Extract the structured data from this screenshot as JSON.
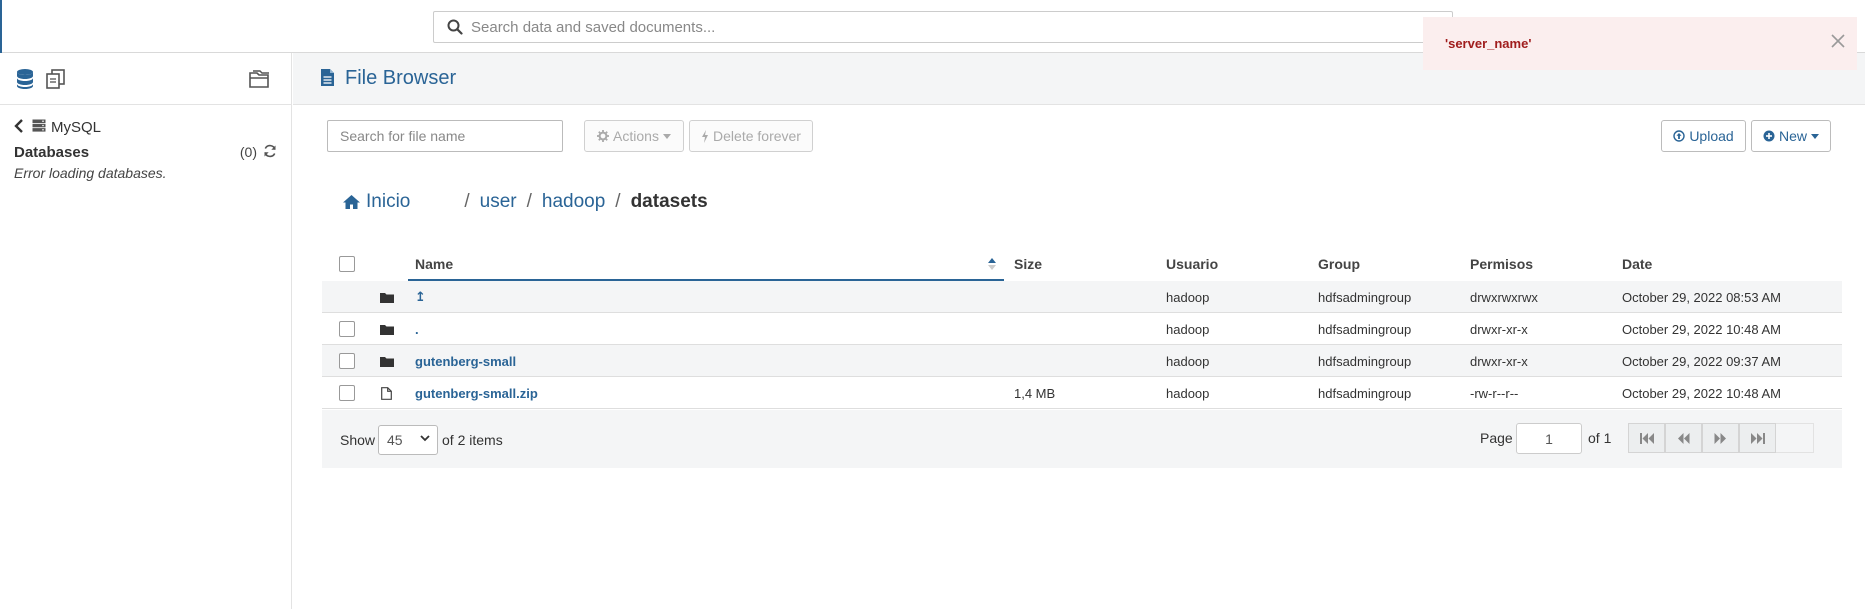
{
  "topbar": {
    "search_placeholder": "Search data and saved documents..."
  },
  "sidebar": {
    "tools": [
      "database-icon",
      "documents-icon",
      "folder-open-icon"
    ],
    "back_label": "MySQL",
    "databases_title": "Databases",
    "databases_count": "(0)",
    "error_text": "Error loading databases."
  },
  "main": {
    "title": "File Browser",
    "file_search_placeholder": "Search for file name",
    "actions_label": "Actions",
    "delete_label": "Delete forever",
    "upload_label": "Upload",
    "new_label": "New"
  },
  "breadcrumb": {
    "home": "Inicio",
    "segments": [
      "user",
      "hadoop"
    ],
    "current": "datasets"
  },
  "table": {
    "columns": [
      "Name",
      "Size",
      "Usuario",
      "Group",
      "Permisos",
      "Date"
    ],
    "rows": [
      {
        "name": "↥",
        "size": "",
        "user": "hadoop",
        "group": "hdfsadmingroup",
        "perms": "drwxrwxrwx",
        "date": "October 29, 2022 08:53 AM",
        "type": "folder-up"
      },
      {
        "name": ".",
        "size": "",
        "user": "hadoop",
        "group": "hdfsadmingroup",
        "perms": "drwxr-xr-x",
        "date": "October 29, 2022 10:48 AM",
        "type": "folder"
      },
      {
        "name": "gutenberg-small",
        "size": "",
        "user": "hadoop",
        "group": "hdfsadmingroup",
        "perms": "drwxr-xr-x",
        "date": "October 29, 2022 09:37 AM",
        "type": "folder"
      },
      {
        "name": "gutenberg-small.zip",
        "size": "1,4 MB",
        "user": "hadoop",
        "group": "hdfsadmingroup",
        "perms": "-rw-r--r--",
        "date": "October 29, 2022 10:48 AM",
        "type": "file"
      }
    ]
  },
  "footer": {
    "show_label": "Show",
    "page_size": "45",
    "of_items": "of 2 items",
    "page_label": "Page",
    "page_value": "1",
    "of_pages": "of 1"
  },
  "toast": {
    "message": "'server_name'"
  },
  "colors": {
    "accent": "#2a6496",
    "toast_bg": "#fbeeee",
    "toast_text": "#a01d1d"
  }
}
